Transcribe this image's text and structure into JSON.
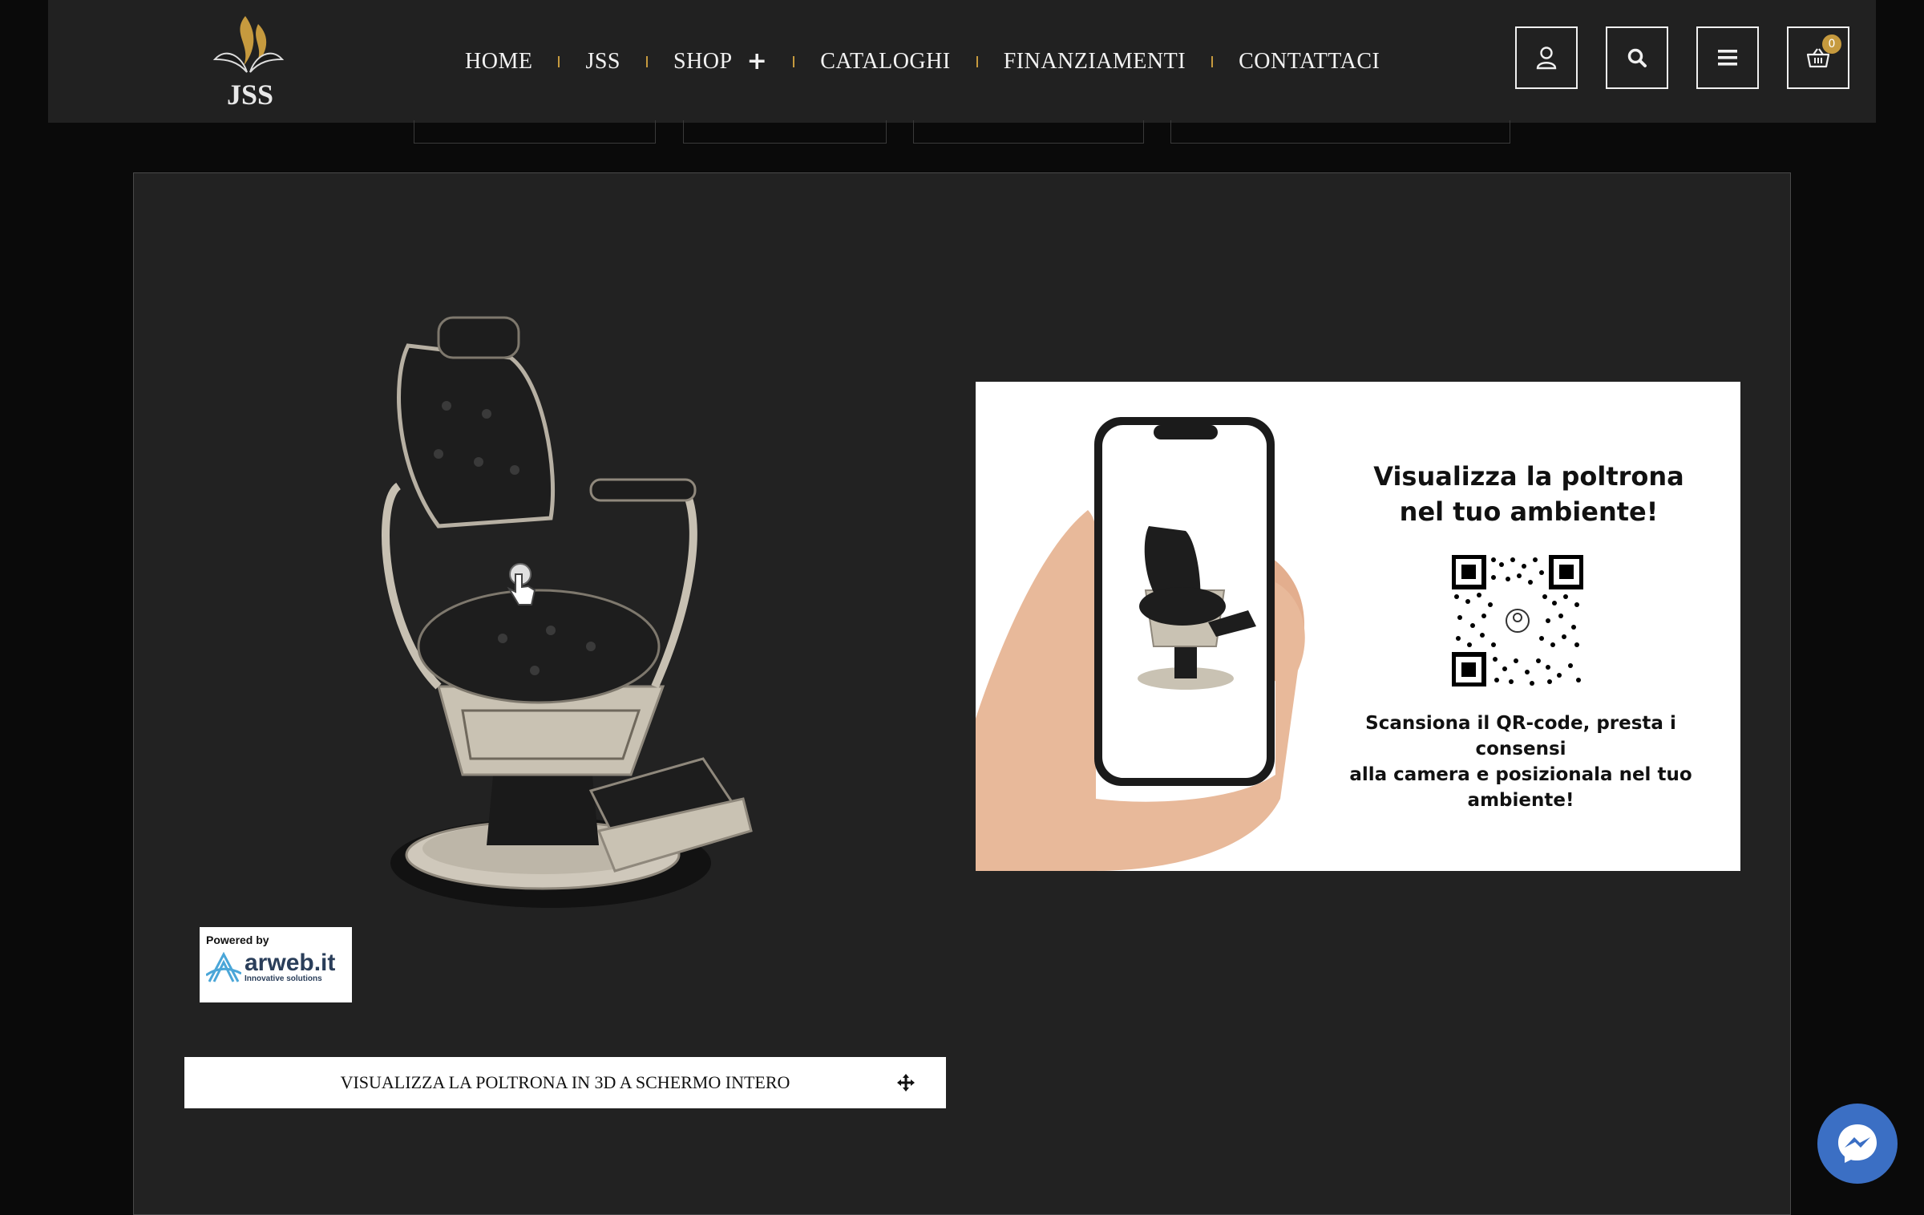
{
  "header": {
    "logo_text": "JSS",
    "nav": [
      {
        "label": "HOME"
      },
      {
        "label": "JSS"
      },
      {
        "label": "SHOP",
        "expand": "+"
      },
      {
        "label": "CATALOGHI"
      },
      {
        "label": "FINANZIAMENTI"
      },
      {
        "label": "CONTATTACI"
      }
    ],
    "icons": [
      "user-icon",
      "search-icon",
      "menu-icon",
      "cart-icon"
    ],
    "cart_count": "0",
    "accent_color": "#c69a3e"
  },
  "viewer": {
    "powered_by": "Powered by",
    "brand": "arweb.it",
    "brand_tagline": "Innovative solutions",
    "fullscreen_label": "VISUALIZZA LA POLTRONA IN 3D A SCHERMO INTERO"
  },
  "ar_banner": {
    "title_line1": "Visualizza la poltrona",
    "title_line2": "nel tuo ambiente!",
    "desc_line1": "Scansiona il QR-code, presta i consensi",
    "desc_line2": "alla camera e posizionala nel tuo",
    "desc_line3": "ambiente!"
  },
  "messenger": {
    "icon": "messenger-icon",
    "color": "#3b6fc4"
  }
}
